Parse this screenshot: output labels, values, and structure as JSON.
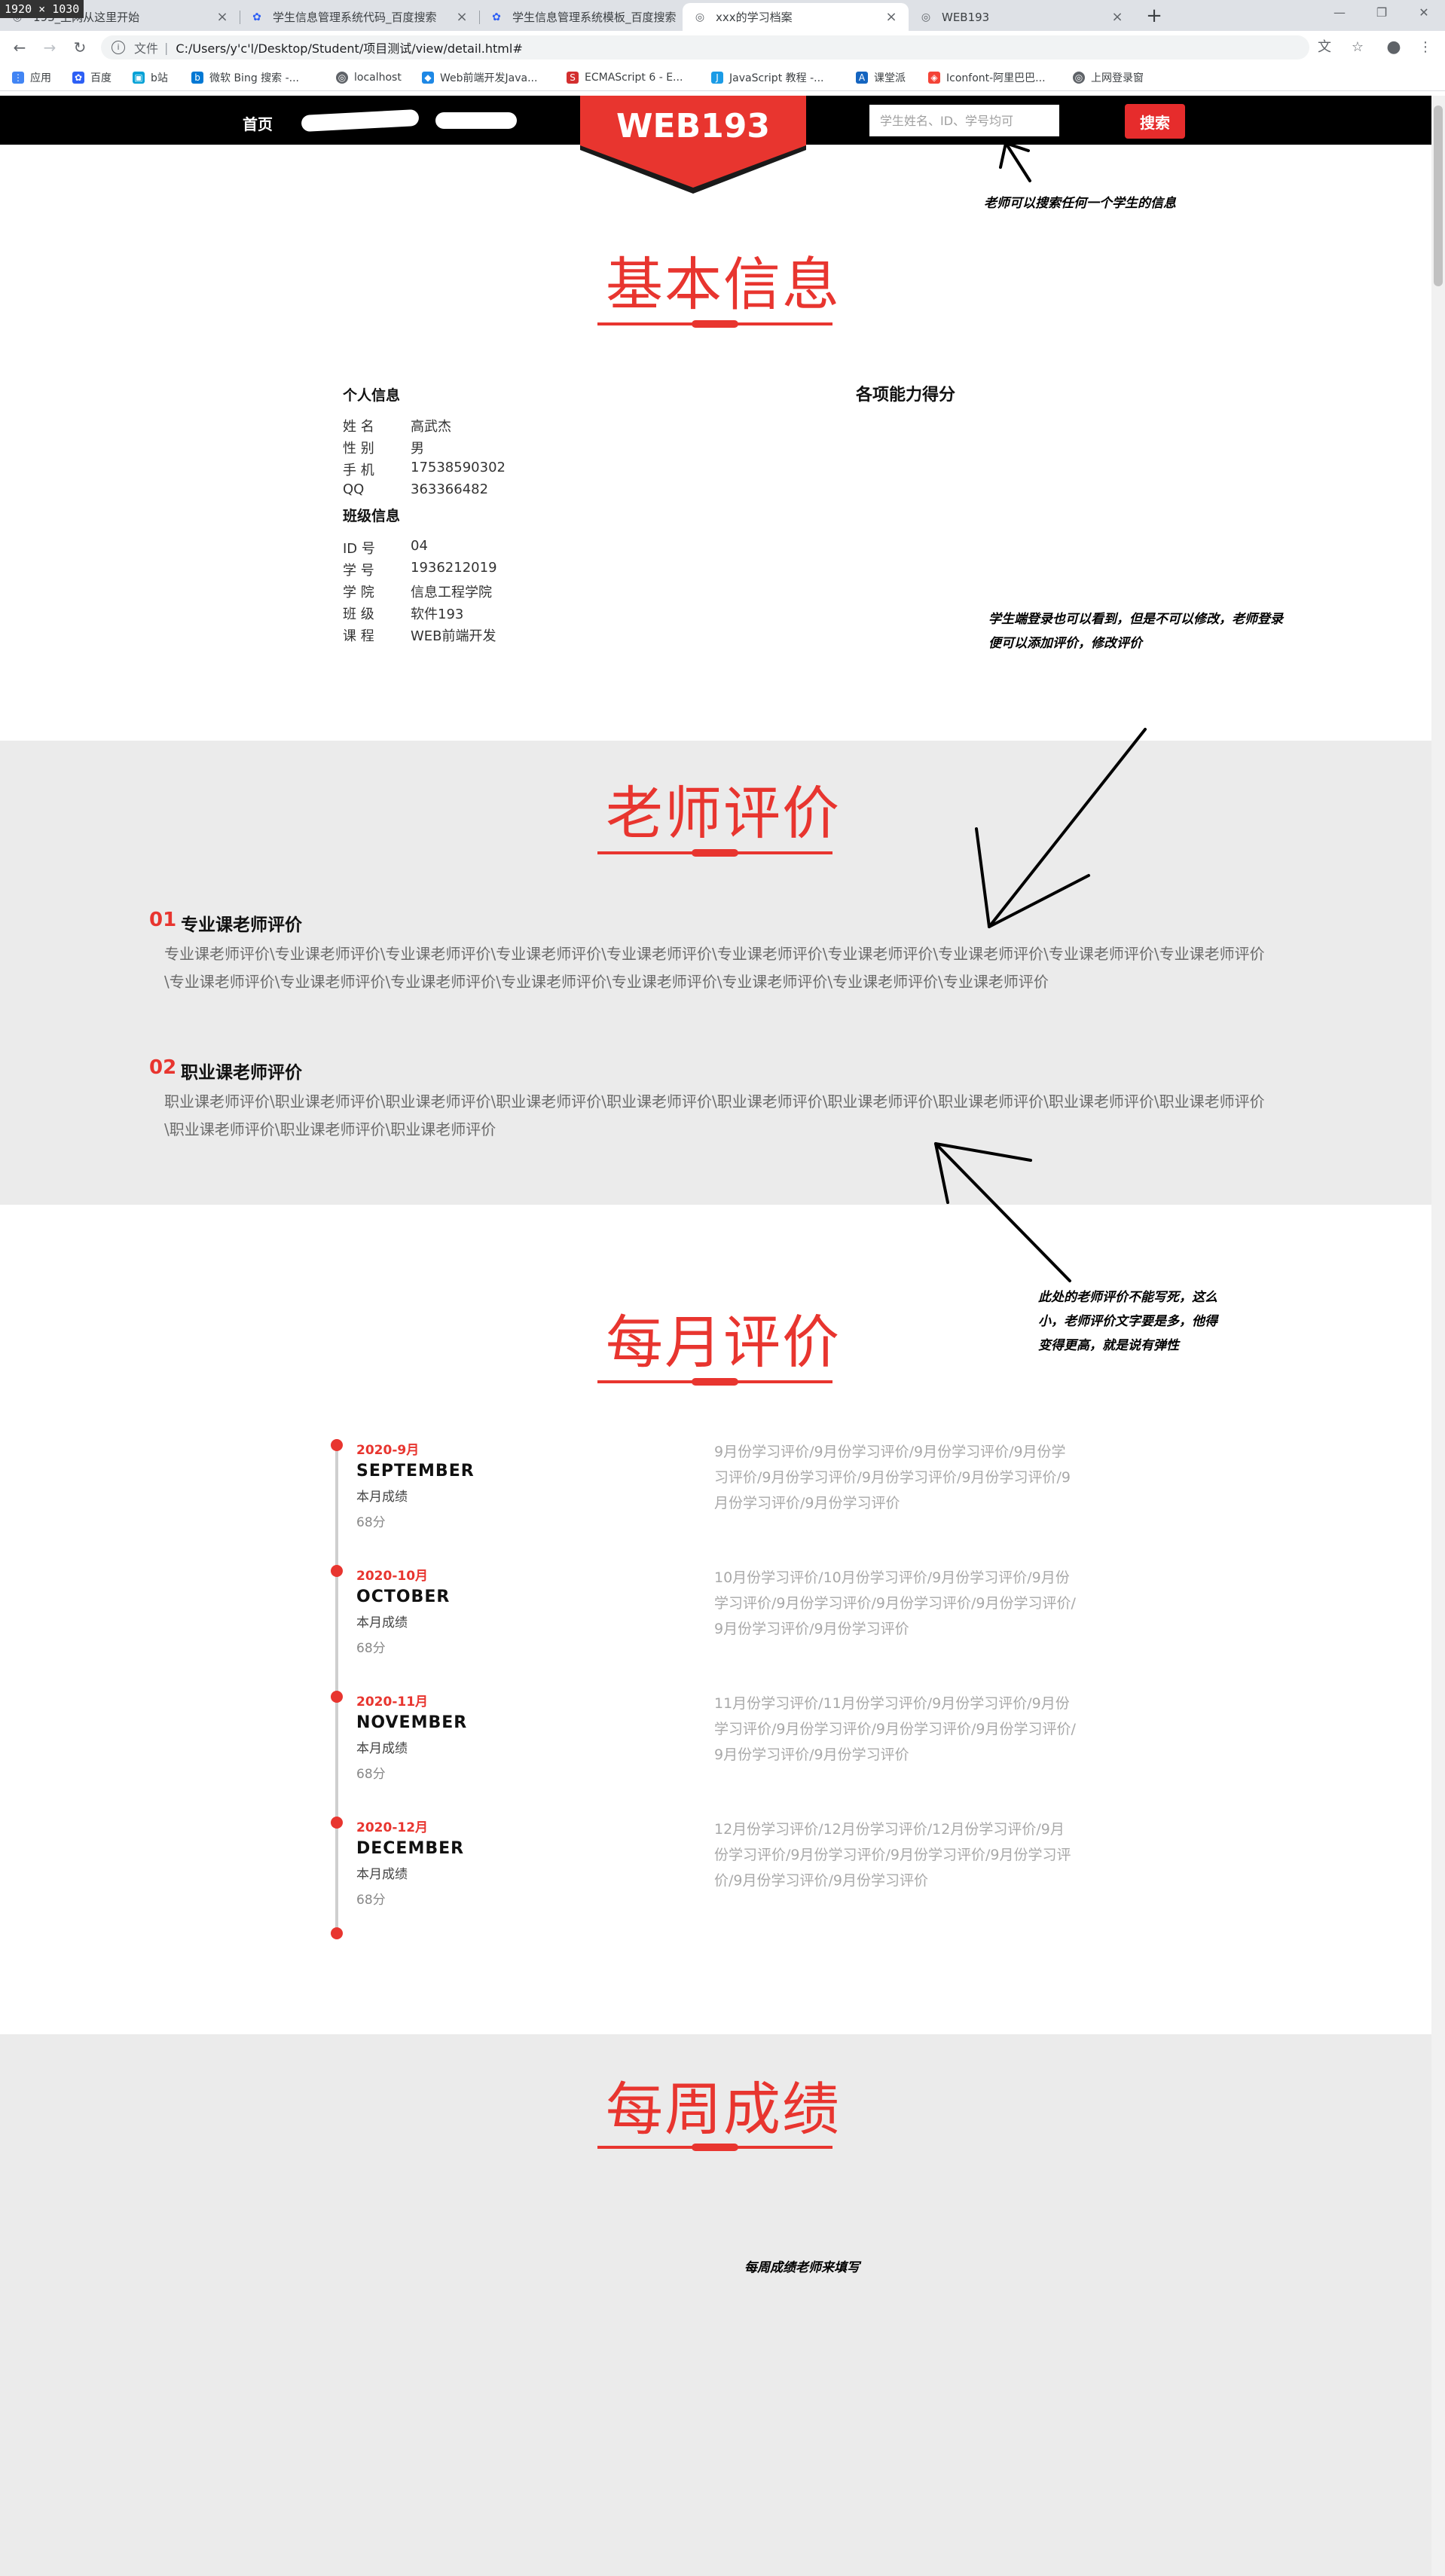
{
  "browser": {
    "size_badge": "1920 × 1030",
    "tabs": [
      {
        "label": "193_上网从这里开始",
        "close": "×"
      },
      {
        "label": "学生信息管理系统代码_百度搜索",
        "close": "×"
      },
      {
        "label": "学生信息管理系统模板_百度搜索",
        "close": "×"
      },
      {
        "label": "xxx的学习档案",
        "close": "×"
      },
      {
        "label": "WEB193",
        "close": "×"
      }
    ],
    "new_tab": "+",
    "address": {
      "scheme_label": "文件",
      "url": "C:/Users/y'c'l/Desktop/Student/项目测试/view/detail.html#"
    },
    "bookmarks": [
      {
        "label": "应用",
        "color": "#4285f4"
      },
      {
        "label": "百度",
        "color": "#2d5ff5"
      },
      {
        "label": "b站",
        "color": "#00a1d6"
      },
      {
        "label": "微软 Bing 搜索 -...",
        "color": "#0078d4"
      },
      {
        "label": "localhost",
        "color": "#5f6368"
      },
      {
        "label": "Web前端开发Java...",
        "color": "#1e88e5"
      },
      {
        "label": "ECMAScript 6 - E...",
        "color": "#d32f2f"
      },
      {
        "label": "JavaScript 教程 -...",
        "color": "#1a9be6"
      },
      {
        "label": "课堂派",
        "color": "#1565c0"
      },
      {
        "label": "Iconfont-阿里巴巴...",
        "color": "#f44336"
      },
      {
        "label": "上网登录窗",
        "color": "#5f6368"
      }
    ]
  },
  "nav": {
    "home": "首页",
    "brand": "WEB193",
    "search_placeholder": "学生姓名、ID、学号均可",
    "search_button": "搜索"
  },
  "basic": {
    "title": "基本信息",
    "personal_heading": "个人信息",
    "personal": [
      {
        "k": "姓  名",
        "v": "高武杰"
      },
      {
        "k": "性  别",
        "v": "男"
      },
      {
        "k": "手  机",
        "v": "17538590302"
      },
      {
        "k": "QQ",
        "v": "363366482"
      }
    ],
    "class_heading": "班级信息",
    "class": [
      {
        "k": "ID 号",
        "v": "04"
      },
      {
        "k": "学  号",
        "v": "1936212019"
      },
      {
        "k": "学  院",
        "v": "信息工程学院"
      },
      {
        "k": "班  级",
        "v": "软件193"
      },
      {
        "k": "课  程",
        "v": "WEB前端开发"
      }
    ],
    "ability_title": "各项能力得分"
  },
  "teacher": {
    "title": "老师评价",
    "items": [
      {
        "num": "01",
        "heading": "专业课老师评价",
        "text": "专业课老师评价\\专业课老师评价\\专业课老师评价\\专业课老师评价\\专业课老师评价\\专业课老师评价\\专业课老师评价\\专业课老师评价\\专业课老师评价\\专业课老师评价\\专业课老师评价\\专业课老师评价\\专业课老师评价\\专业课老师评价\\专业课老师评价\\专业课老师评价\\专业课老师评价\\专业课老师评价"
      },
      {
        "num": "02",
        "heading": "职业课老师评价",
        "text": "职业课老师评价\\职业课老师评价\\职业课老师评价\\职业课老师评价\\职业课老师评价\\职业课老师评价\\职业课老师评价\\职业课老师评价\\职业课老师评价\\职业课老师评价\\职业课老师评价\\职业课老师评价\\职业课老师评价"
      }
    ]
  },
  "monthly": {
    "title": "每月评价",
    "items": [
      {
        "date": "2020-9月",
        "month": "SEPTEMBER",
        "label": "本月成绩",
        "score": "68分",
        "desc": "9月份学习评价/9月份学习评价/9月份学习评价/9月份学习评价/9月份学习评价/9月份学习评价/9月份学习评价/9月份学习评价/9月份学习评价"
      },
      {
        "date": "2020-10月",
        "month": "OCTOBER",
        "label": "本月成绩",
        "score": "68分",
        "desc": "10月份学习评价/10月份学习评价/9月份学习评价/9月份学习评价/9月份学习评价/9月份学习评价/9月份学习评价/9月份学习评价/9月份学习评价"
      },
      {
        "date": "2020-11月",
        "month": "NOVEMBER",
        "label": "本月成绩",
        "score": "68分",
        "desc": "11月份学习评价/11月份学习评价/9月份学习评价/9月份学习评价/9月份学习评价/9月份学习评价/9月份学习评价/9月份学习评价/9月份学习评价"
      },
      {
        "date": "2020-12月",
        "month": "DECEMBER",
        "label": "本月成绩",
        "score": "68分",
        "desc": "12月份学习评价/12月份学习评价/12月份学习评价/9月份学习评价/9月份学习评价/9月份学习评价/9月份学习评价/9月份学习评价/9月份学习评价"
      }
    ]
  },
  "weekly": {
    "title": "每周成绩"
  },
  "annotations": {
    "search": "老师可以搜索任何一个学生的信息",
    "student_view": [
      "学生端登录也可以看到，但是不可以修改，老师登录",
      "便可以添加评价，修改评价"
    ],
    "flexible": [
      "此处的老师评价不能写死，这么",
      "小，老师评价文字要是多，他得",
      "变得更高，就是说有弹性"
    ],
    "weekly": "每周成绩老师来填写"
  },
  "colors": {
    "accent": "#e8352f",
    "search_button": "#e62c2c",
    "nav_bg": "#000000",
    "band_gray": "#ebebeb"
  }
}
